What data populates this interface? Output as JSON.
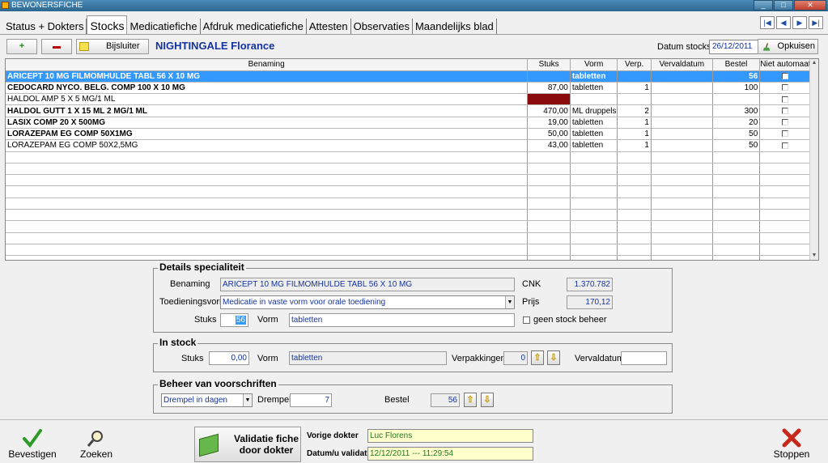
{
  "window": {
    "title": "BEWONERSFICHE",
    "min": "_",
    "max": "□",
    "close": "✕"
  },
  "tabs": [
    {
      "label": "Status + Dokters"
    },
    {
      "label": "Stocks"
    },
    {
      "label": "Medicatiefiche"
    },
    {
      "label": "Afdruk medicatiefiche"
    },
    {
      "label": "Attesten"
    },
    {
      "label": "Observaties"
    },
    {
      "label": "Maandelijks blad"
    }
  ],
  "nav": {
    "first": "|◀",
    "prev": "◀",
    "next": "▶",
    "last": "▶|"
  },
  "toolbar": {
    "add": "+",
    "bijsluiter": "Bijsluiter",
    "patient": "NIGHTINGALE Florance",
    "date_label": "Datum stocks",
    "date_value": "26/12/2011",
    "opkuisen": "Opkuisen"
  },
  "grid": {
    "columns": [
      "Benaming",
      "Stuks",
      "Vorm",
      "Verp.",
      "Vervaldatum",
      "Bestel",
      "Niet automaat"
    ],
    "rows": [
      {
        "name": "ARICEPT 10 MG FILMOMHULDE TABL 56 X 10 MG",
        "stuks": "",
        "vorm": "tabletten",
        "verp": "",
        "verval": "",
        "bestel": "56"
      },
      {
        "name": "CEDOCARD NYCO. BELG. COMP  100 X 10 MG",
        "stuks": "87,00",
        "vorm": "tabletten",
        "verp": "1",
        "verval": "",
        "bestel": "100"
      },
      {
        "name": "HALDOL AMP 5 X 5 MG/1 ML",
        "stuks": "",
        "vorm": "",
        "verp": "",
        "verval": "",
        "bestel": ""
      },
      {
        "name": "HALDOL GUTT 1 X 15 ML  2 MG/1 ML",
        "stuks": "470,00",
        "vorm": "ML druppels",
        "verp": "2",
        "verval": "",
        "bestel": "300"
      },
      {
        "name": "LASIX COMP  20 X 500MG",
        "stuks": "19,00",
        "vorm": "tabletten",
        "verp": "1",
        "verval": "",
        "bestel": "20"
      },
      {
        "name": "LORAZEPAM EG COMP 50X1MG",
        "stuks": "50,00",
        "vorm": "tabletten",
        "verp": "1",
        "verval": "",
        "bestel": "50"
      },
      {
        "name": "LORAZEPAM EG COMP 50X2,5MG",
        "stuks": "43,00",
        "vorm": "tabletten",
        "verp": "1",
        "verval": "",
        "bestel": "50"
      }
    ]
  },
  "details": {
    "legend": "Details specialiteit",
    "benaming_label": "Benaming",
    "benaming": "ARICEPT 10 MG FILMOMHULDE TABL 56 X 10 MG",
    "cnk_label": "CNK",
    "cnk": "1.370.782",
    "toediening_label": "Toedieningsvorm",
    "toediening": "Medicatie in vaste vorm voor orale toediening",
    "prijs_label": "Prijs",
    "prijs": "170,12",
    "stuks_label": "Stuks",
    "stuks": "56",
    "vorm_label": "Vorm",
    "vorm": "tabletten",
    "geen_stock": "geen stock beheer"
  },
  "instock": {
    "legend": "In stock",
    "stuks_label": "Stuks",
    "stuks": "0,00",
    "vorm_label": "Vorm",
    "vorm": "tabletten",
    "verp_label": "Verpakkingen",
    "verp": "0",
    "verval_label": "Vervaldatum",
    "verval": ""
  },
  "beheer": {
    "legend": "Beheer van voorschriften",
    "mode": "Drempel in dagen",
    "drempel_label": "Drempel",
    "drempel": "7",
    "bestel_label": "Bestel",
    "bestel": "56"
  },
  "footer": {
    "bevestigen": "Bevestigen",
    "zoeken": "Zoeken",
    "validatie_line1": "Validatie fiche",
    "validatie_line2": "door dokter",
    "vorige_label": "Vorige dokter",
    "vorige": "Luc Florens",
    "datum_label": "Datum/u validatie",
    "datum": "12/12/2011 --- 11:29:54",
    "stoppen": "Stoppen"
  },
  "colors": {
    "selection": "#3399ff",
    "brand_text": "#1432a0",
    "dark_cell": "#8b0c0c"
  }
}
